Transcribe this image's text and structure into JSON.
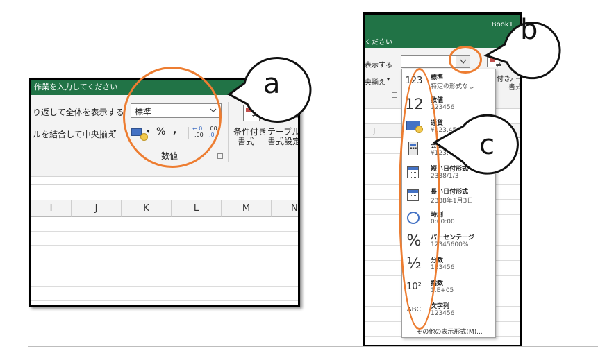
{
  "left_screenshot": {
    "title_fragment": "作業を入力してください",
    "ribbon": {
      "wrap_text": "り返して全体を表示する",
      "merge_center": "ルを結合して中央揃え",
      "dropdown_marker": "▾",
      "number_format_value": "標準",
      "percent_symbol": "%",
      "comma_symbol": ",",
      "increase_decimal": ".00",
      "decrease_decimal": ".0",
      "number_group_label": "数値",
      "conditional_format_line1": "条件付き",
      "conditional_format_line2": "書式",
      "table_format_line1": "テーブルと",
      "table_format_line2": "書式設定"
    },
    "columns": [
      "I",
      "J",
      "K",
      "L",
      "M",
      "N"
    ]
  },
  "right_screenshot": {
    "title": "Book1",
    "hint_fragment": "ください",
    "ribbon": {
      "wrap_text": "表示する",
      "merge_center": "央揃え",
      "cond_fragment": "付き",
      "table_fragment": "テーブ",
      "table_fragment2": "書式",
      "column_label": "J"
    },
    "menu": {
      "items": [
        {
          "icon_text": "123",
          "name": "標準",
          "example": "特定の形式なし"
        },
        {
          "icon_text": "12",
          "name": "数値",
          "example": "123456"
        },
        {
          "icon_text": "",
          "name": "通貨",
          "example": "¥123,456"
        },
        {
          "icon_text": "",
          "name": "会計",
          "example": "¥123,456"
        },
        {
          "icon_text": "",
          "name": "短い日付形式",
          "example": "2338/1/3"
        },
        {
          "icon_text": "",
          "name": "長い日付形式",
          "example": "2338年1月3日"
        },
        {
          "icon_text": "",
          "name": "時刻",
          "example": "0:00:00"
        },
        {
          "icon_text": "%",
          "name": "パーセンテージ",
          "example": "12345600%"
        },
        {
          "icon_text": "½",
          "name": "分数",
          "example": "123456"
        },
        {
          "icon_text": "10²",
          "name": "指数",
          "example": "1.E+05"
        },
        {
          "icon_text": "ABC",
          "name": "文字列",
          "example": "123456"
        }
      ],
      "more_formats": "その他の表示形式(M)..."
    }
  },
  "annotations": {
    "a": "a",
    "b": "b",
    "c": "c",
    "highlight_color": "#ed7d31"
  },
  "colors": {
    "excel_green": "#217346",
    "accent_blue": "#4472c4"
  }
}
